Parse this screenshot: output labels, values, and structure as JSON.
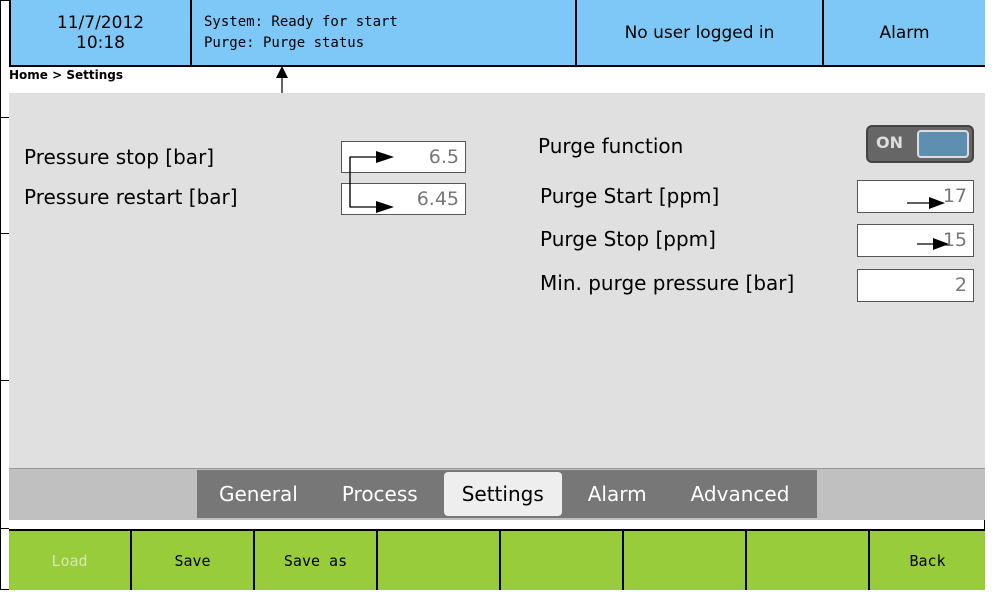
{
  "header": {
    "date": "11/7/2012",
    "time": "10:18",
    "system_status": "System: Ready for start",
    "purge_status": "Purge: Purge status",
    "user_status": "No user logged in",
    "alarm_label": "Alarm",
    "accent_color": "#7ec8f8"
  },
  "breadcrumb": "Home > Settings",
  "settings": {
    "pressure_stop": {
      "label": "Pressure stop [bar]",
      "value": "6.5"
    },
    "pressure_restart": {
      "label": "Pressure restart [bar]",
      "value": "6.45"
    },
    "purge_function": {
      "label": "Purge function",
      "toggle_label": "ON"
    },
    "purge_start": {
      "label": "Purge Start [ppm]",
      "value": "17"
    },
    "purge_stop": {
      "label": "Purge Stop [ppm]",
      "value": "15"
    },
    "min_purge_pressure": {
      "label": "Min. purge pressure [bar]",
      "value": "2"
    }
  },
  "tabs": [
    "General",
    "Process",
    "Settings",
    "Alarm",
    "Advanced"
  ],
  "active_tab": "Settings",
  "footer": {
    "load": "Load",
    "save": "Save",
    "save_as": "Save as",
    "back": "Back",
    "button_color": "#98cc3a"
  }
}
